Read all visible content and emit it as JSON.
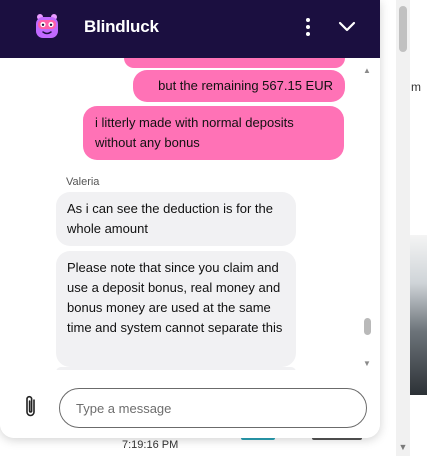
{
  "background": {
    "right_text": "m",
    "time": "7:19:16 PM"
  },
  "header": {
    "brand": "Blindluck",
    "logo_icon": "blindluck-logo-icon",
    "menu_icon": "more-vertical-icon",
    "minimize_icon": "chevron-down-icon",
    "bg_color": "#1b0f40"
  },
  "messages": [
    {
      "from": "user",
      "text": "but the remaining 567.15 EUR"
    },
    {
      "from": "user",
      "text": "i litterly made with normal deposits without any bonus"
    },
    {
      "from": "agent",
      "sender": "Valeria",
      "text": "As i can see the deduction is for the whole amount"
    },
    {
      "from": "agent",
      "text": "Please note that since you claim and use a deposit bonus, real money and bonus money are used at the same time and system cannot separate this"
    }
  ],
  "composer": {
    "placeholder": "Type a message",
    "attach_icon": "paperclip-icon"
  },
  "colors": {
    "user_bubble": "#ff72b6",
    "agent_bubble": "#f1f1f3"
  }
}
